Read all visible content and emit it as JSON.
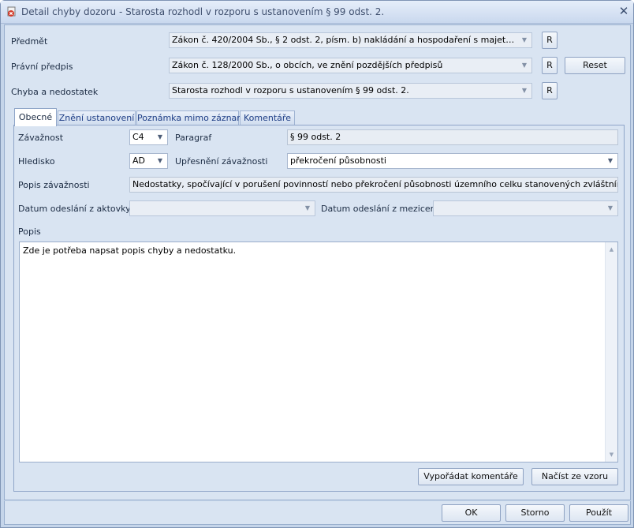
{
  "window": {
    "title": "Detail chyby dozoru - Starosta rozhodl v rozporu s ustanovením § 99 odst. 2.",
    "close_glyph": "✕"
  },
  "top_fields": {
    "predmet_label": "Předmět",
    "predmet_value": "Zákon č. 420/2004 Sb., § 2 odst. 2, písm. b) nakládání a hospodaření s majetkem státu, ...",
    "pravni_predpis_label": "Právní předpis",
    "pravni_predpis_value": "Zákon č. 128/2000 Sb., o obcích, ve znění pozdějších předpisů",
    "chyba_label": "Chyba a nedostatek",
    "chyba_value": "Starosta rozhodl v rozporu s ustanovením § 99 odst. 2.",
    "r_label": "R",
    "reset_label": "Reset"
  },
  "tabs": [
    {
      "label": "Obecné"
    },
    {
      "label": "Znění ustanovení"
    },
    {
      "label": "Poznámka mimo záznam"
    },
    {
      "label": "Komentáře"
    }
  ],
  "general": {
    "zavaznost_label": "Závažnost",
    "zavaznost_value": "C4",
    "paragraf_label": "Paragraf",
    "paragraf_value": "§ 99 odst. 2",
    "hledisko_label": "Hledisko",
    "hledisko_value": "AD",
    "upresneni_label": "Upřesnění závažnosti",
    "upresneni_value": "překročení působnosti",
    "popis_zavaznosti_label": "Popis závažnosti",
    "popis_zavaznosti_value": "Nedostatky, spočívající v porušení povinností nebo překročení působnosti územního celku stanovených zvláštními právními předpi",
    "datum_aktovky_label": "Datum odeslání z aktovky",
    "datum_aktovky_value": "",
    "datum_mezicentra_label": "Datum odeslání z mezicentra",
    "datum_mezicentra_value": "",
    "popis_label": "Popis",
    "popis_value": "Zde je potřeba napsat popis chyby a nedostatku.",
    "vyporadat_label": "Vypořádat komentáře",
    "nacist_label": "Načíst ze vzoru"
  },
  "footer": {
    "ok_label": "OK",
    "storno_label": "Storno",
    "pouzit_label": "Použít"
  }
}
